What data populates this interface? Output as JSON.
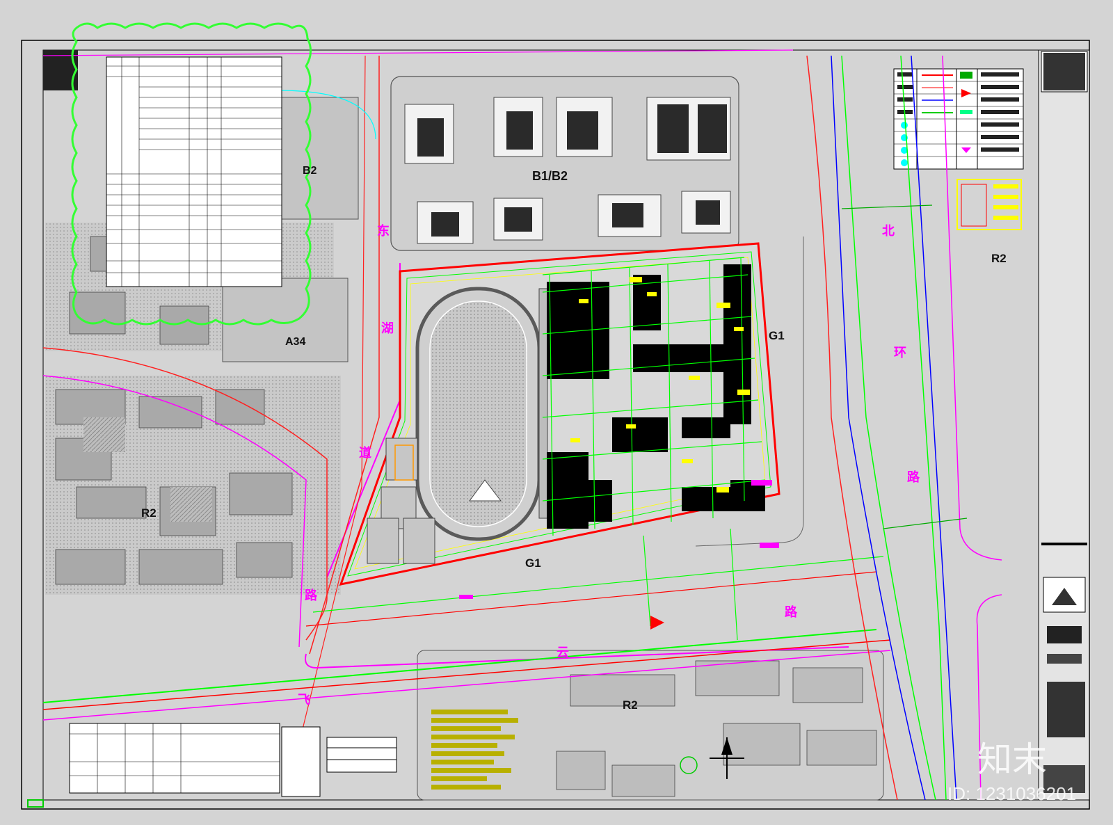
{
  "drawing": {
    "labels": {
      "r2_east": "R2",
      "r2_west": "R2",
      "r2_south": "R2",
      "b1_b2": "B1/B2",
      "b2": "B2",
      "a34": "A34",
      "g1_south": "G1",
      "g1_east": "G1"
    },
    "road_chars": {
      "west_1": "东",
      "west_2": "湖",
      "west_3": "道",
      "west_4": "路",
      "east_1": "北",
      "east_2": "环",
      "east_3": "路",
      "south_1": "路",
      "south_2": "云",
      "south_3": "飞"
    }
  },
  "watermark": {
    "brand": "知末",
    "id": "ID: 1231036201"
  },
  "colors": {
    "background": "#d4d4d4",
    "site_boundary": "#ff0000",
    "pipe_green": "#00ff00",
    "road_magenta": "#ff00ff",
    "road_red": "#ff2020",
    "road_blue": "#0000ff",
    "revision_cloud": "#33ff33",
    "building": "#000000",
    "tag_yellow": "#ffff00"
  }
}
